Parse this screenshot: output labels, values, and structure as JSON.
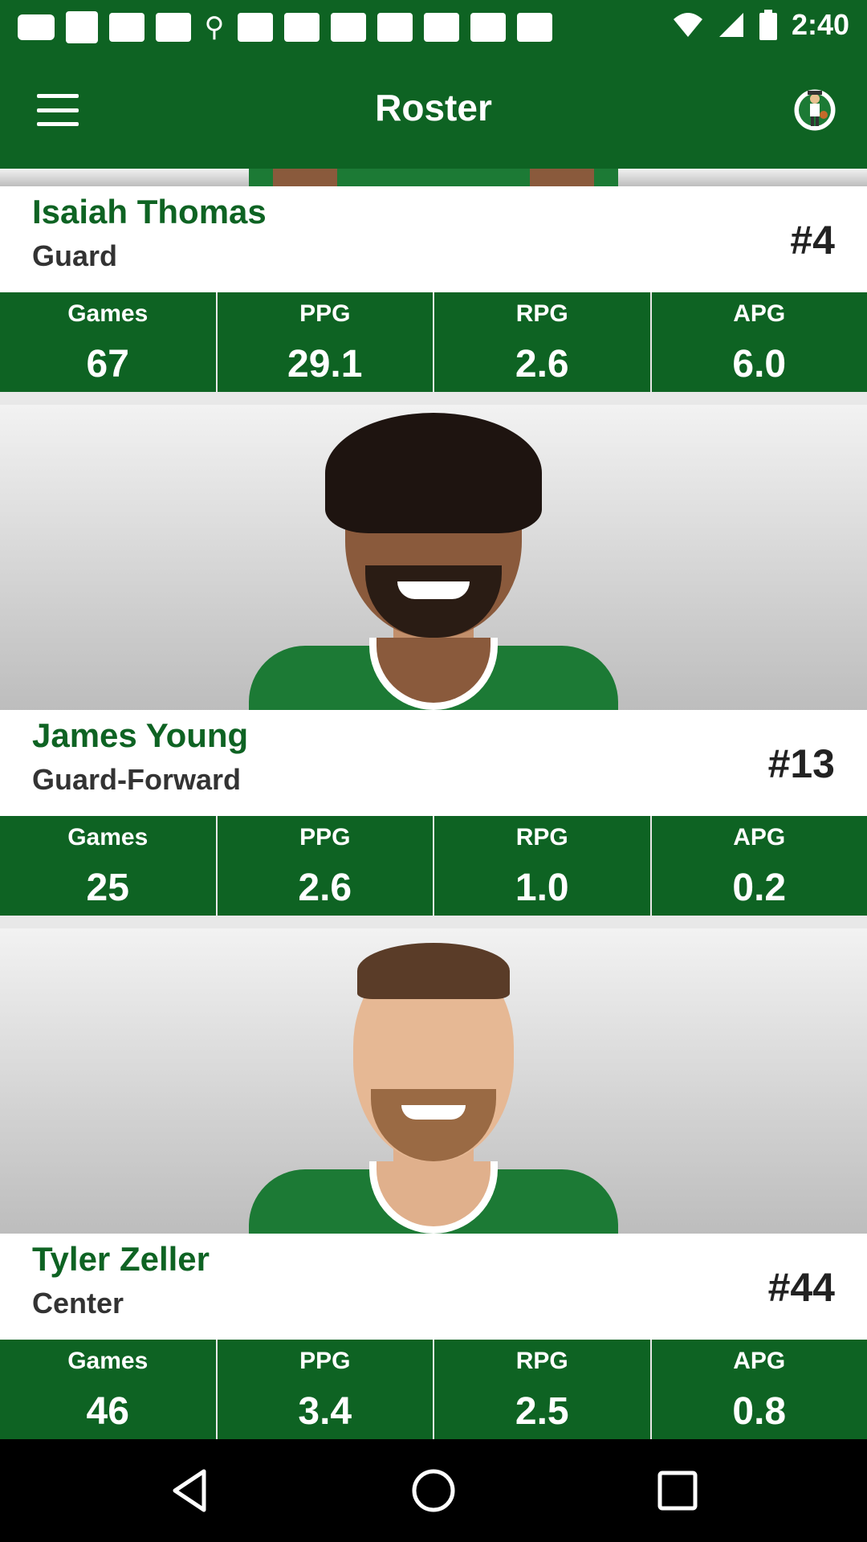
{
  "status_bar": {
    "time": "2:40"
  },
  "app_bar": {
    "title": "Roster"
  },
  "players": [
    {
      "name": "Isaiah Thomas",
      "position": "Guard",
      "number": "#4",
      "stats": [
        {
          "label": "Games",
          "value": "67"
        },
        {
          "label": "PPG",
          "value": "29.1"
        },
        {
          "label": "RPG",
          "value": "2.6"
        },
        {
          "label": "APG",
          "value": "6.0"
        }
      ]
    },
    {
      "name": "James Young",
      "position": "Guard-Forward",
      "number": "#13",
      "stats": [
        {
          "label": "Games",
          "value": "25"
        },
        {
          "label": "PPG",
          "value": "2.6"
        },
        {
          "label": "RPG",
          "value": "1.0"
        },
        {
          "label": "APG",
          "value": "0.2"
        }
      ]
    },
    {
      "name": "Tyler Zeller",
      "position": "Center",
      "number": "#44",
      "stats": [
        {
          "label": "Games",
          "value": "46"
        },
        {
          "label": "PPG",
          "value": "3.4"
        },
        {
          "label": "RPG",
          "value": "2.5"
        },
        {
          "label": "APG",
          "value": "0.8"
        }
      ]
    }
  ],
  "colors": {
    "primary": "#0e6323",
    "jersey": "#1c7a35"
  },
  "icons": {
    "menu": "hamburger-menu-icon",
    "logo": "celtics-logo-icon",
    "back": "back-triangle-icon",
    "home": "home-circle-icon",
    "recents": "recents-square-icon"
  }
}
